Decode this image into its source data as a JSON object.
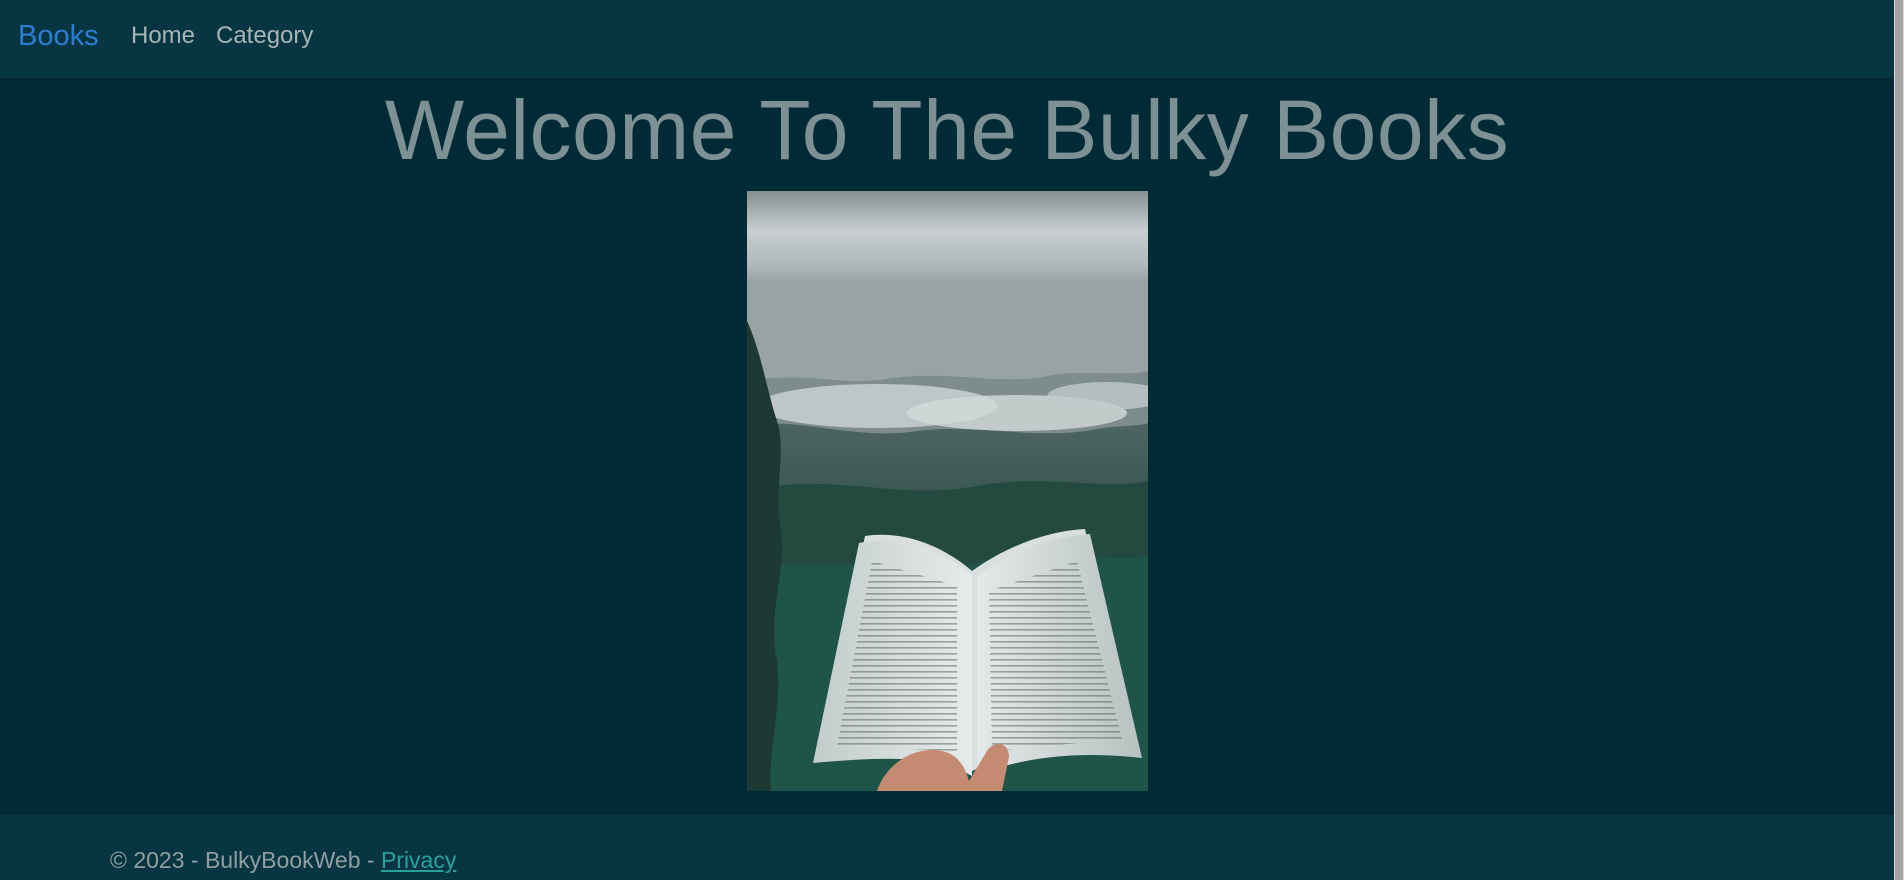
{
  "navbar": {
    "brand": "Books",
    "links": [
      {
        "label": "Home"
      },
      {
        "label": "Category"
      }
    ]
  },
  "main": {
    "title": "Welcome To The Bulky Books"
  },
  "footer": {
    "copyright": "© 2023 - BulkyBookWeb - ",
    "privacy_label": "Privacy"
  },
  "colors": {
    "background": "#002b36",
    "navbar_bg": "#073642",
    "brand": "#2a7fd4",
    "link": "#2aa198",
    "title": "#7d9093"
  }
}
